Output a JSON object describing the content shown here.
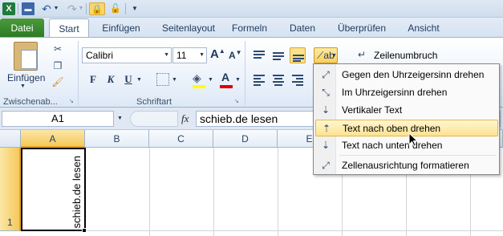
{
  "qat": {
    "excel_icon": "excel-logo-icon",
    "save_icon": "save-icon",
    "undo_icon": "undo-icon",
    "redo_icon": "redo-icon",
    "lock_icons": [
      "lock-icon",
      "lock-icon"
    ],
    "customize_icon": "customize-qat-icon"
  },
  "tabs": {
    "file": "Datei",
    "items": [
      "Start",
      "Einfügen",
      "Seitenlayout",
      "Formeln",
      "Daten",
      "Überprüfen",
      "Ansicht"
    ],
    "active": "Start"
  },
  "ribbon": {
    "clipboard": {
      "paste_label": "Einfügen",
      "group_label": "Zwischenab..."
    },
    "font": {
      "font_name": "Calibri",
      "font_size": "11",
      "grow_label": "A",
      "shrink_label": "A",
      "bold_label": "F",
      "italic_label": "K",
      "underline_label": "U",
      "font_color_label": "A",
      "fill_color": "#ffff00",
      "font_color": "#e00000",
      "group_label": "Schriftart"
    },
    "alignment": {
      "wrap_label": "Zeilenumbruch",
      "active_icon": "align-bottom-icon"
    }
  },
  "formula_bar": {
    "name_box": "A1",
    "fx_label": "fx",
    "formula": "schieb.de lesen"
  },
  "grid": {
    "columns": [
      "A",
      "B",
      "C",
      "D",
      "E"
    ],
    "rows": [
      "1"
    ],
    "cell_a1": "schieb.de lesen",
    "selected_cell": "A1"
  },
  "orientation_menu": {
    "items": [
      {
        "label": "Gegen den Uhrzeigersinn drehen",
        "icon": "rotate-ccw-icon"
      },
      {
        "label": "Im Uhrzeigersinn drehen",
        "icon": "rotate-cw-icon"
      },
      {
        "label": "Vertikaler Text",
        "icon": "vertical-text-icon"
      },
      {
        "label": "Text nach oben drehen",
        "icon": "rotate-up-icon",
        "highlighted": true
      },
      {
        "label": "Text nach unten drehen",
        "icon": "rotate-down-icon"
      },
      {
        "label": "Zellenausrichtung formatieren",
        "icon": "format-alignment-icon"
      }
    ]
  },
  "colors": {
    "file_tab": "#2b7a24",
    "selection_header": "#f6c85a",
    "menu_highlight": "#fde38f"
  }
}
